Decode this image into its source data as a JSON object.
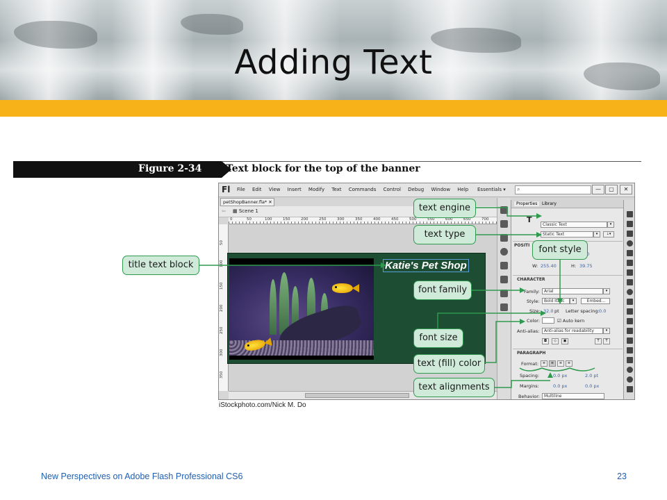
{
  "slide": {
    "title": "Adding Text",
    "footer": "New Perspectives on Adobe Flash Professional CS6",
    "page_number": "23"
  },
  "figure": {
    "label": "Figure 2-34",
    "caption": "Text block for the top of the banner",
    "credit": "iStockphoto.com/Nick M. Do"
  },
  "flash": {
    "logo": "Fl",
    "menus": [
      "File",
      "Edit",
      "View",
      "Insert",
      "Modify",
      "Text",
      "Commands",
      "Control",
      "Debug",
      "Window",
      "Help"
    ],
    "workspace": "Essentials ▾",
    "search_placeholder": "",
    "window_buttons": [
      "—",
      "▢",
      "✕"
    ],
    "document_tab": "petShopBanner.fla* ✕",
    "scene": "Scene 1",
    "ruler_ticks": [
      "0",
      "50",
      "100",
      "150",
      "200",
      "250",
      "300",
      "350",
      "400",
      "450",
      "500",
      "550",
      "600",
      "650",
      "700"
    ],
    "ruler_left_ticks": [
      "50",
      "100",
      "150",
      "200",
      "250",
      "300",
      "350"
    ],
    "banner_text": "Katie's Pet Shop",
    "properties": {
      "tabs": [
        "Properties",
        "Library"
      ],
      "text_engine": "Classic Text",
      "text_type": "Static Text",
      "position_label": "POSITI",
      "x_value": "00",
      "w_label": "W:",
      "w_value": "255.40",
      "h_label": "H:",
      "h_value": "39.75",
      "character_label": "CHARACTER",
      "family_label": "Family:",
      "family_value": "Arial",
      "style_label": "Style:",
      "style_value": "Bold Italic",
      "embed_label": "Embed...",
      "size_label": "Size:",
      "size_value": "32.0",
      "size_unit": "pt",
      "letter_spacing_label": "Letter spacing:",
      "letter_spacing_value": "0.0",
      "color_label": "Color:",
      "auto_kern_label": "Auto kern",
      "anti_alias_label": "Anti-alias:",
      "anti_alias_value": "Anti-alias for readability",
      "paragraph_label": "PARAGRAPH",
      "format_label": "Format:",
      "spacing_label": "Spacing:",
      "spacing_value_1": "0.0 px",
      "spacing_value_2": "2.0 pt",
      "margins_label": "Margins:",
      "margins_value_1": "0.0 px",
      "margins_value_2": "0.0 px",
      "behavior_label": "Behavior:",
      "behavior_value": "Multiline"
    }
  },
  "callouts": {
    "title_text_block": "title text block",
    "text_engine": "text engine",
    "text_type": "text type",
    "font_style": "font style",
    "font_family": "font family",
    "font_size": "font size",
    "text_fill_color": "text (fill) color",
    "text_alignments": "text alignments"
  },
  "colors": {
    "gold_bar": "#f8b219",
    "callout_fill": "#cfead9",
    "callout_border": "#2f9a4e",
    "banner_green": "#1d4d33",
    "footer_text": "#1f5fb0"
  }
}
